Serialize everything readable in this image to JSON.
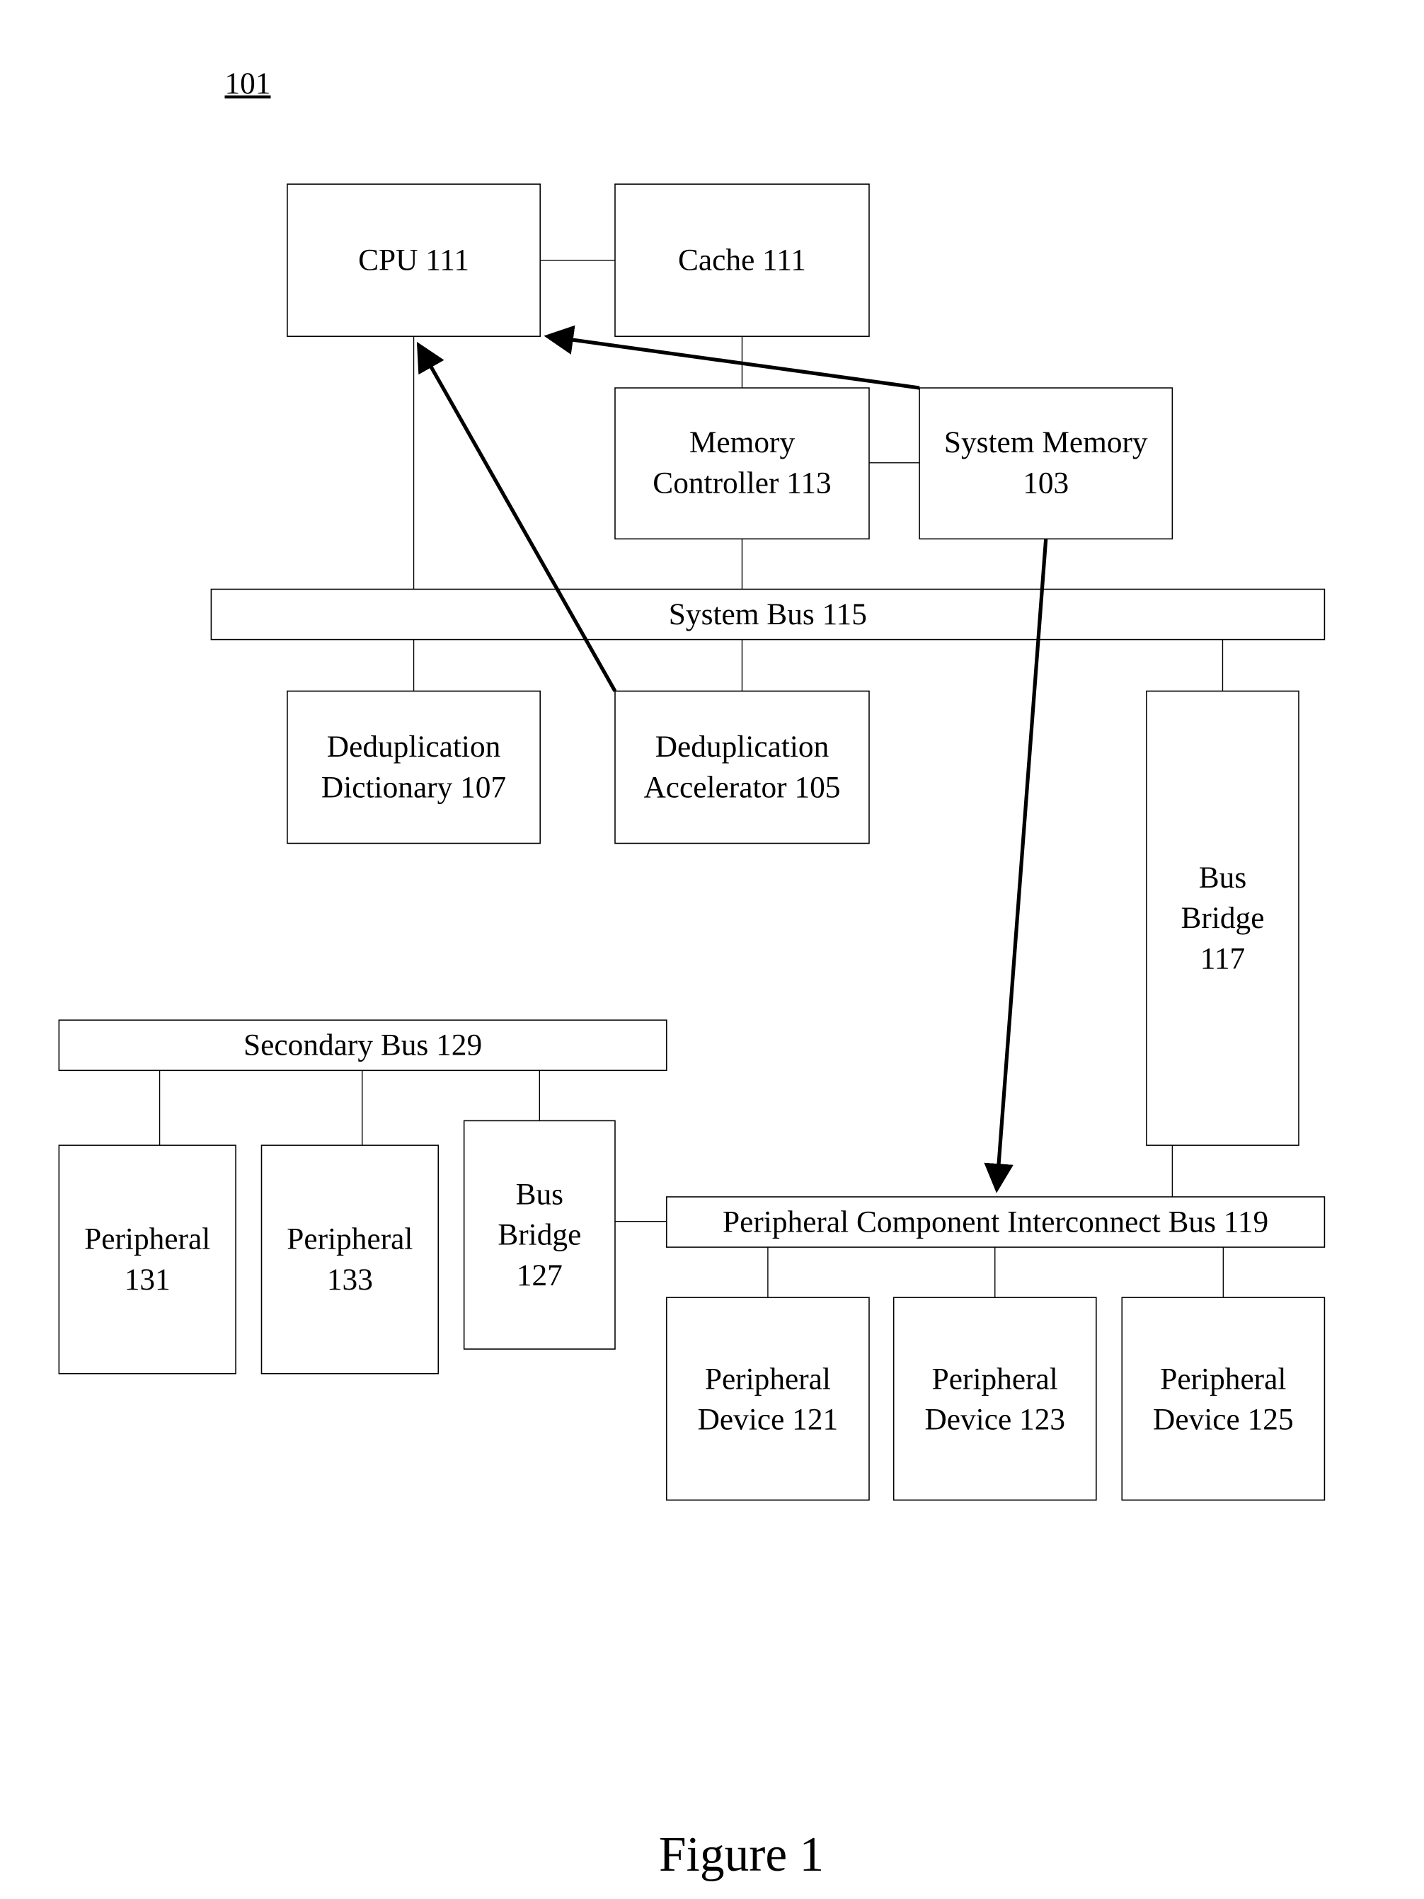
{
  "figure": {
    "reference_label": "101",
    "caption": "Figure 1"
  },
  "nodes": {
    "cpu": {
      "lines": [
        "CPU 111"
      ]
    },
    "cache": {
      "lines": [
        "Cache 111"
      ]
    },
    "memory_controller": {
      "lines": [
        "Memory",
        "Controller 113"
      ]
    },
    "system_memory": {
      "lines": [
        "System Memory",
        "103"
      ]
    },
    "system_bus": {
      "lines": [
        "System Bus 115"
      ]
    },
    "dedup_dictionary": {
      "lines": [
        "Deduplication",
        "Dictionary 107"
      ]
    },
    "dedup_accelerator": {
      "lines": [
        "Deduplication",
        "Accelerator 105"
      ]
    },
    "bus_bridge_117": {
      "lines": [
        "Bus",
        "Bridge",
        "117"
      ]
    },
    "secondary_bus": {
      "lines": [
        "Secondary Bus 129"
      ]
    },
    "peripheral_131": {
      "lines": [
        "Peripheral",
        "131"
      ]
    },
    "peripheral_133": {
      "lines": [
        "Peripheral",
        "133"
      ]
    },
    "bus_bridge_127": {
      "lines": [
        "Bus",
        "Bridge",
        "127"
      ]
    },
    "pci_bus": {
      "lines": [
        "Peripheral Component Interconnect Bus 119"
      ]
    },
    "peripheral_device_121": {
      "lines": [
        "Peripheral",
        "Device 121"
      ]
    },
    "peripheral_device_123": {
      "lines": [
        "Peripheral",
        "Device 123"
      ]
    },
    "peripheral_device_125": {
      "lines": [
        "Peripheral",
        "Device 125"
      ]
    }
  },
  "connections": [
    {
      "from": "cpu",
      "to": "cache",
      "type": "line"
    },
    {
      "from": "cache",
      "to": "memory_controller",
      "type": "line"
    },
    {
      "from": "memory_controller",
      "to": "system_memory",
      "type": "line"
    },
    {
      "from": "cpu",
      "to": "system_bus",
      "type": "line"
    },
    {
      "from": "memory_controller",
      "to": "system_bus",
      "type": "line"
    },
    {
      "from": "system_bus",
      "to": "dedup_dictionary",
      "type": "line"
    },
    {
      "from": "system_bus",
      "to": "dedup_accelerator",
      "type": "line"
    },
    {
      "from": "system_bus",
      "to": "bus_bridge_117",
      "type": "line"
    },
    {
      "from": "bus_bridge_117",
      "to": "pci_bus",
      "type": "line"
    },
    {
      "from": "pci_bus",
      "to": "peripheral_device_121",
      "type": "line"
    },
    {
      "from": "pci_bus",
      "to": "peripheral_device_123",
      "type": "line"
    },
    {
      "from": "pci_bus",
      "to": "peripheral_device_125",
      "type": "line"
    },
    {
      "from": "bus_bridge_127",
      "to": "pci_bus",
      "type": "line"
    },
    {
      "from": "secondary_bus",
      "to": "peripheral_131",
      "type": "line"
    },
    {
      "from": "secondary_bus",
      "to": "peripheral_133",
      "type": "line"
    },
    {
      "from": "secondary_bus",
      "to": "bus_bridge_127",
      "type": "line"
    },
    {
      "from": "system_memory",
      "to": "cpu",
      "type": "arrow"
    },
    {
      "from": "dedup_accelerator",
      "to": "cpu",
      "type": "arrow"
    },
    {
      "from": "system_memory",
      "to": "pci_bus",
      "type": "arrow"
    }
  ]
}
